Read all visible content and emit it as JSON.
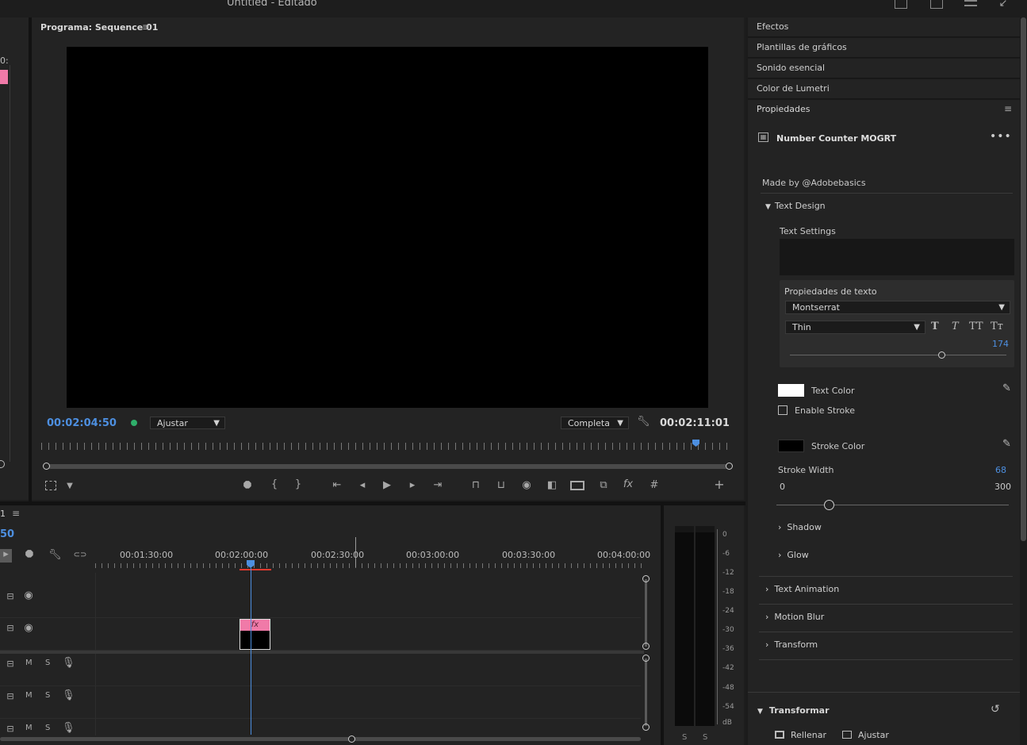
{
  "window": {
    "title_main": "Untitled",
    "title_suffix": " - Editado"
  },
  "program_monitor": {
    "title": "Programa: Sequence 01",
    "current_timecode": "00:02:04:50",
    "duration_timecode": "00:02:11:01",
    "zoom_select": "Ajustar",
    "quality_select": "Completa"
  },
  "left_fragment": {
    "label": "0:"
  },
  "timeline": {
    "tab_label": "1",
    "timecode_fragment": "50",
    "ruler_ticks": [
      "00:01:30:00",
      "00:02:00:00",
      "00:02:30:00",
      "00:03:00:00",
      "00:03:30:00",
      "00:04:00:00"
    ],
    "clip_fx_label": "fx",
    "audio_track_letters": {
      "mute": "M",
      "solo": "S"
    }
  },
  "audio_meter": {
    "scale": [
      "0",
      "-6",
      "-12",
      "-18",
      "-24",
      "-30",
      "-36",
      "-42",
      "-48",
      "-54",
      "dB"
    ],
    "solo_labels": [
      "S",
      "S"
    ]
  },
  "right_panels": {
    "items": [
      "Efectos",
      "Plantillas de gráficos",
      "Sonido esencial",
      "Color de Lumetri"
    ],
    "properties_title": "Propiedades"
  },
  "properties": {
    "mogrt_name": "Number Counter MOGRT",
    "made_by": "Made by @Adobebasics",
    "text_design_label": "Text Design",
    "text_settings_label": "Text Settings",
    "text_props_title": "Propiedades de texto",
    "font_family": "Montserrat",
    "font_style": "Thin",
    "style_buttons": [
      "T",
      "T",
      "TT",
      "Tт"
    ],
    "font_size": "174",
    "font_size_fraction": 0.7,
    "text_color_label": "Text Color",
    "text_color": "#ffffff",
    "enable_stroke_label": "Enable Stroke",
    "enable_stroke_checked": false,
    "stroke_color_label": "Stroke Color",
    "stroke_color": "#000000",
    "stroke_width_label": "Stroke Width",
    "stroke_width_value": "68",
    "stroke_min": "0",
    "stroke_max": "300",
    "collapsed_groups_inner": [
      "Shadow",
      "Glow"
    ],
    "collapsed_groups_outer": [
      "Text Animation",
      "Motion Blur",
      "Transform"
    ],
    "transform_section_title": "Transformar",
    "fill_button": "Rellenar",
    "fit_button": "Ajustar"
  },
  "colors": {
    "accent_blue": "#4d8fe0",
    "clip_pink": "#f07aa8",
    "status_green": "#2fae6a",
    "inout_red": "#e03a2e"
  }
}
